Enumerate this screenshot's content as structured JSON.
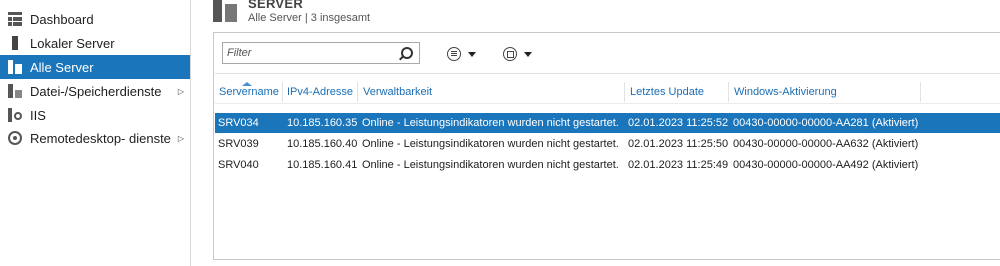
{
  "sidebar": {
    "items": [
      {
        "label": "Dashboard",
        "icon": "dashboard-icon"
      },
      {
        "label": "Lokaler Server",
        "icon": "server-icon"
      },
      {
        "label": "Alle Server",
        "icon": "all-servers-icon",
        "active": true
      },
      {
        "label": "Datei-/Speicherdienste",
        "icon": "storage-icon",
        "has_submenu": true
      },
      {
        "label": "IIS",
        "icon": "iis-icon"
      },
      {
        "label": "Remotedesktop- dienste",
        "icon": "remote-desktop-icon",
        "has_submenu": true
      }
    ],
    "submenu_arrow": "▷"
  },
  "header": {
    "title": "SERVER",
    "subtitle": "Alle Server | 3 insgesamt"
  },
  "toolbar": {
    "filter_placeholder": "Filter",
    "list_button_icon": "list-options-icon",
    "save_button_icon": "save-query-icon"
  },
  "table": {
    "columns": [
      "Servername",
      "IPv4-Adresse",
      "Verwaltbarkeit",
      "Letztes Update",
      "Windows-Aktivierung"
    ],
    "rows": [
      {
        "name": "SRV034",
        "ip": "10.185.160.35",
        "status": "Online - Leistungsindikatoren wurden nicht gestartet.",
        "updated": "02.01.2023 11:25:52",
        "activation": "00430-00000-00000-AA281 (Aktiviert)",
        "selected": true
      },
      {
        "name": "SRV039",
        "ip": "10.185.160.40",
        "status": "Online - Leistungsindikatoren wurden nicht gestartet.",
        "updated": "02.01.2023 11:25:50",
        "activation": "00430-00000-00000-AA632 (Aktiviert)"
      },
      {
        "name": "SRV040",
        "ip": "10.185.160.41",
        "status": "Online - Leistungsindikatoren wurden nicht gestartet.",
        "updated": "02.01.2023 11:25:49",
        "activation": "00430-00000-00000-AA492 (Aktiviert)"
      }
    ]
  },
  "colors": {
    "accent": "#1b75bb",
    "header_link": "#1b6fb5"
  }
}
